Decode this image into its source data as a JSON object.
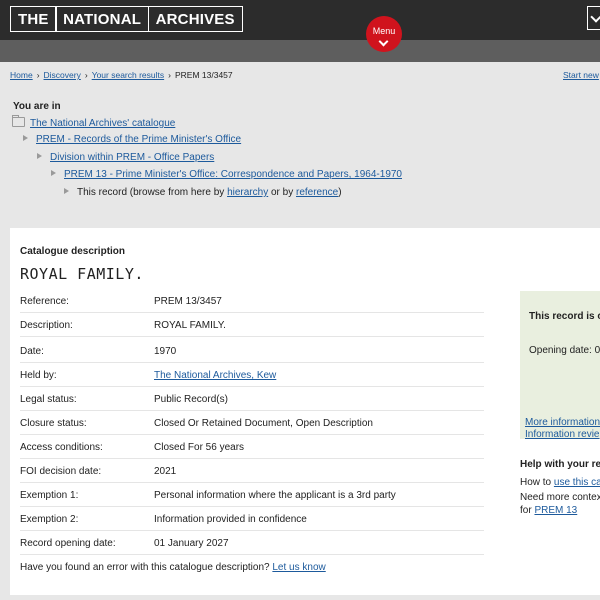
{
  "header": {
    "logo_words": [
      "THE",
      "NATIONAL",
      "ARCHIVES"
    ],
    "menu_label": "Menu"
  },
  "breadcrumb": {
    "items": [
      "Home",
      "Discovery",
      "Your search results"
    ],
    "current": "PREM 13/3457",
    "start_new": "Start new"
  },
  "you_are_in": {
    "heading": "You are in",
    "level0": "The National Archives' catalogue",
    "level1": "PREM - Records of the Prime Minister's Office",
    "level2": "Division within PREM - Office Papers",
    "level3": "PREM 13 - Prime Minister's Office: Correspondence and Papers, 1964-1970",
    "this_record_prefix": "This record (browse from here by",
    "hierarchy": "hierarchy",
    "or_by": "or by",
    "reference": "reference",
    "close_paren": ")"
  },
  "catalogue": {
    "label": "Catalogue description",
    "title": "ROYAL FAMILY.",
    "rows": [
      {
        "label": "Reference:",
        "value": "PREM 13/3457"
      },
      {
        "label": "Description:",
        "value": "ROYAL FAMILY."
      },
      {
        "label": "Date:",
        "value": "1970"
      },
      {
        "label": "Held by:",
        "value": "The National Archives, Kew"
      },
      {
        "label": "Legal status:",
        "value": "Public Record(s)"
      },
      {
        "label": "Closure status:",
        "value": "Closed Or Retained Document, Open Description"
      },
      {
        "label": "Access conditions:",
        "value": "Closed For 56 years"
      },
      {
        "label": "FOI decision date:",
        "value": "2021"
      },
      {
        "label": "Exemption 1:",
        "value": "Personal information where the applicant is a 3rd party"
      },
      {
        "label": "Exemption 2:",
        "value": "Information provided in confidence"
      },
      {
        "label": "Record opening date:",
        "value": "01 January 2027"
      }
    ],
    "feedback_text": "Have you found an error with this catalogue description?",
    "feedback_link": "Let us know"
  },
  "sidebar": {
    "closure_title": "This record is clo",
    "opening_date": "Opening date: 0",
    "more_info": "More information",
    "info_review": "Information revie",
    "help_heading": "Help with your res",
    "help_line1_prefix": "How to",
    "help_line1_link": "use this ca",
    "help_line2": "Need more contex",
    "help_line3_prefix": "for",
    "help_line3_link": "PREM 13"
  }
}
